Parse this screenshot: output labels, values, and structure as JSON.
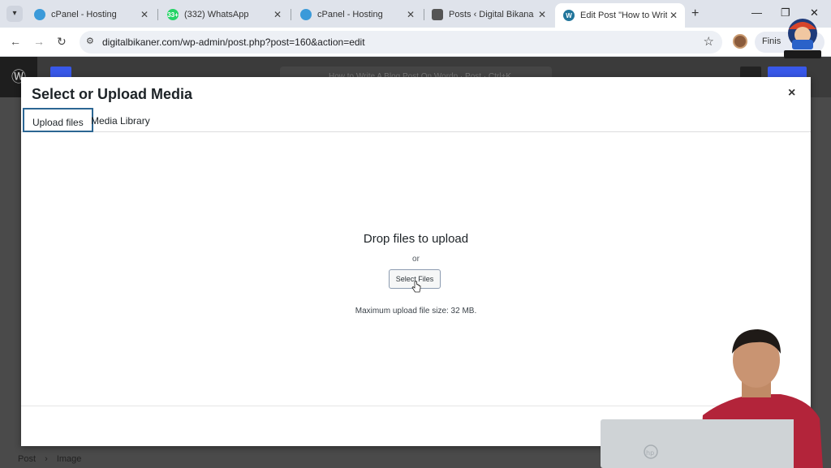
{
  "browser": {
    "tabs": [
      {
        "title": "cPanel - Hosting",
        "icon": "cpanel-icon",
        "color": "#3b9ad9"
      },
      {
        "title": "(332) WhatsApp",
        "icon": "whatsapp-icon",
        "color": "#25d366",
        "badge": "33+"
      },
      {
        "title": "cPanel - Hosting",
        "icon": "cpanel-icon",
        "color": "#3b9ad9"
      },
      {
        "title": "Posts ‹ Digital Bikana — V",
        "icon": "ghost-icon",
        "color": "#555555"
      },
      {
        "title": "Edit Post \"How to Write A",
        "icon": "wordpress-icon",
        "color": "#21759b",
        "active": true
      }
    ],
    "url": "digitalbikaner.com/wp-admin/post.php?post=160&action=edit",
    "finish_label": "Finis"
  },
  "editor": {
    "title_hint": "How to Write A Blog Post On Wordp  ·  Post  ·  Ctrl+K",
    "breadcrumb": [
      "Post",
      "›",
      "Image"
    ]
  },
  "modal": {
    "title": "Select or Upload Media",
    "close": "×",
    "tabs": [
      {
        "label": "Upload files",
        "active": true
      },
      {
        "label": "Media Library",
        "active": false
      }
    ],
    "drop_text": "Drop files to upload",
    "or_text": "or",
    "select_button": "Select Files",
    "max_size": "Maximum upload file size: 32 MB."
  },
  "colors": {
    "wp_accent": "#3858e9",
    "tab_focus": "#2c6693"
  }
}
